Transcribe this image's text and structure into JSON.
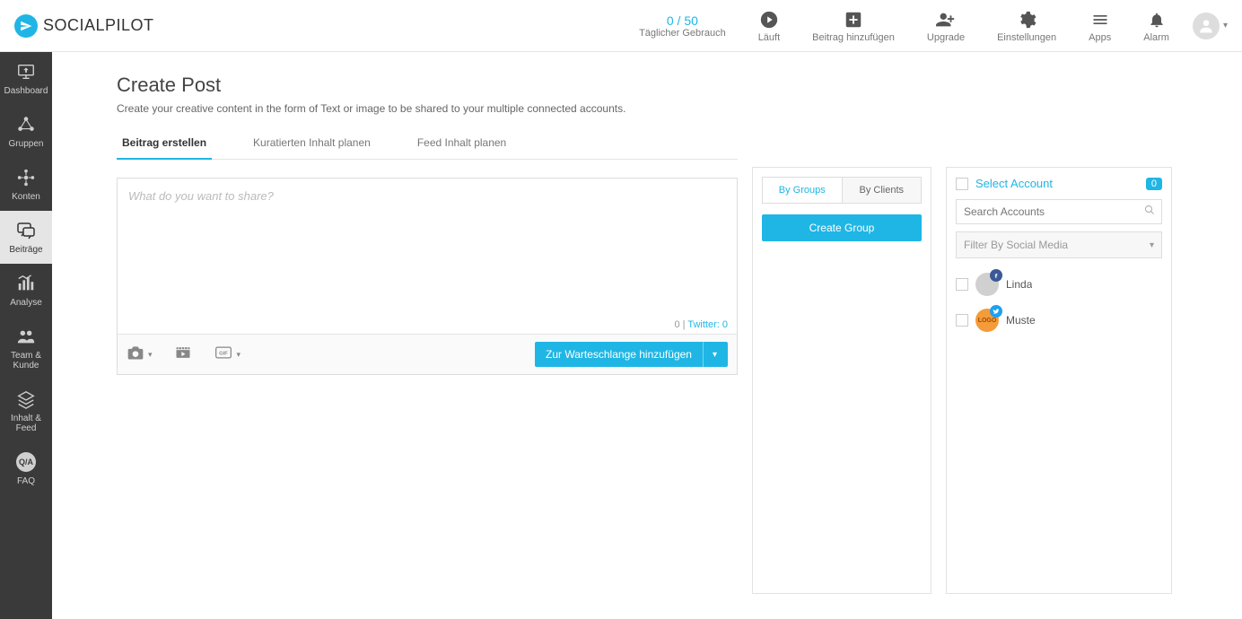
{
  "brand": {
    "name1": "SOCIAL",
    "name2": "PILOT"
  },
  "header": {
    "usage_count": "0 / 50",
    "usage_label": "Täglicher Gebrauch",
    "running": "Läuft",
    "add_post": "Beitrag hinzufügen",
    "upgrade": "Upgrade",
    "settings": "Einstellungen",
    "apps": "Apps",
    "alarm": "Alarm"
  },
  "sidebar": {
    "dashboard": "Dashboard",
    "groups": "Gruppen",
    "accounts": "Konten",
    "posts": "Beiträge",
    "analyse": "Analyse",
    "team": "Team & Kunde",
    "content": "Inhalt & Feed",
    "faq": "FAQ"
  },
  "page": {
    "title": "Create Post",
    "subtitle": "Create your creative content in the form of Text or image to be shared to your multiple connected accounts."
  },
  "tabs": {
    "create": "Beitrag erstellen",
    "curated": "Kuratierten Inhalt planen",
    "feed": "Feed Inhalt planen"
  },
  "composer": {
    "placeholder": "What do you want to share?",
    "counter_zero": "0",
    "counter_sep": " | ",
    "twitter_count": "Twitter: 0",
    "queue_button": "Zur Warteschlange hinzufügen"
  },
  "mid": {
    "by_groups": "By Groups",
    "by_clients": "By Clients",
    "create_group": "Create Group"
  },
  "right": {
    "select_account": "Select Account",
    "selected_count": "0",
    "search_placeholder": "Search Accounts",
    "filter_label": "Filter By Social Media",
    "acct1": "Linda",
    "acct2": "Muste"
  }
}
